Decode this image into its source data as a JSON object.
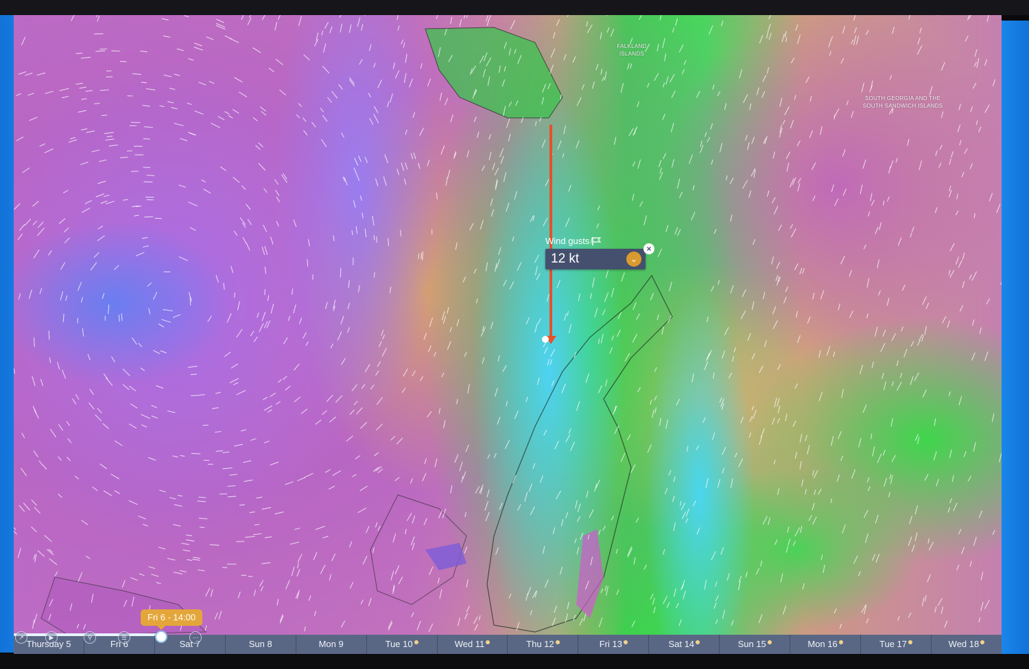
{
  "map": {
    "labels": {
      "falkland": "FALKLAND ISLANDS",
      "south_georgia": "SOUTH GEORGIA AND THE SOUTH SANDWICH ISLANDS"
    }
  },
  "picker": {
    "title": "Wind gusts",
    "value": "12 kt",
    "flag_icon": "flag-icon",
    "expand_icon": "chevron-down-icon",
    "close_icon": "close-icon"
  },
  "timeline": {
    "current_time": "Fri 6 - 14:00",
    "progress_fraction": 0.15,
    "days": [
      {
        "label": "Thursday 5",
        "premium": false
      },
      {
        "label": "Fri 6",
        "premium": false
      },
      {
        "label": "Sat 7",
        "premium": false
      },
      {
        "label": "Sun 8",
        "premium": false
      },
      {
        "label": "Mon 9",
        "premium": false
      },
      {
        "label": "Tue 10",
        "premium": true
      },
      {
        "label": "Wed 11",
        "premium": true
      },
      {
        "label": "Thu 12",
        "premium": true
      },
      {
        "label": "Fri 13",
        "premium": true
      },
      {
        "label": "Sat 14",
        "premium": true
      },
      {
        "label": "Sun 15",
        "premium": true
      },
      {
        "label": "Mon 16",
        "premium": true
      },
      {
        "label": "Tue 17",
        "premium": true
      },
      {
        "label": "Wed 18",
        "premium": true
      }
    ],
    "icons": [
      "zoom-icon",
      "play-icon",
      "search-icon",
      "layers-icon",
      "more-icon"
    ]
  },
  "colors": {
    "measure_line": "#e8502a",
    "picker_bg": "#45506e",
    "accent": "#e4a63a",
    "timeline_bg": "#5a6784"
  }
}
